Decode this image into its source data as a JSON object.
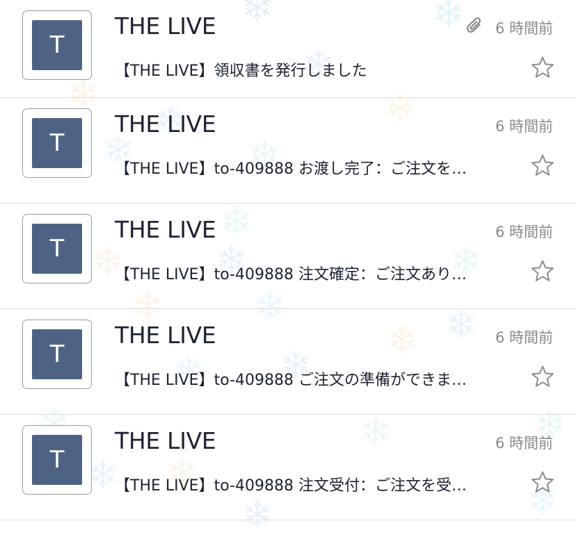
{
  "messages": [
    {
      "avatar_letter": "T",
      "sender": "THE LIVE",
      "time": "6 時間前",
      "subject": "【THE LIVE】領収書を発行しました",
      "has_attachment": true,
      "starred": false
    },
    {
      "avatar_letter": "T",
      "sender": "THE LIVE",
      "time": "6 時間前",
      "subject": "【THE LIVE】to-409888 お渡し完了：ご注文を…",
      "has_attachment": false,
      "starred": false
    },
    {
      "avatar_letter": "T",
      "sender": "THE LIVE",
      "time": "6 時間前",
      "subject": "【THE LIVE】to-409888 注文確定：ご注文あり…",
      "has_attachment": false,
      "starred": false
    },
    {
      "avatar_letter": "T",
      "sender": "THE LIVE",
      "time": "6 時間前",
      "subject": "【THE LIVE】to-409888 ご注文の準備ができま…",
      "has_attachment": false,
      "starred": false
    },
    {
      "avatar_letter": "T",
      "sender": "THE LIVE",
      "time": "6 時間前",
      "subject": "【THE LIVE】to-409888 注文受付：ご注文を受…",
      "has_attachment": false,
      "starred": false
    }
  ],
  "icons": {
    "attachment": "paperclip-icon",
    "star": "star-outline-icon",
    "background": "snowflake-icon"
  },
  "colors": {
    "avatar_bg": "#4e6384",
    "text_primary": "#1c2230",
    "text_secondary": "#8a8a8a",
    "divider": "#dcdcdc",
    "star_outline": "#8a8a8a"
  }
}
